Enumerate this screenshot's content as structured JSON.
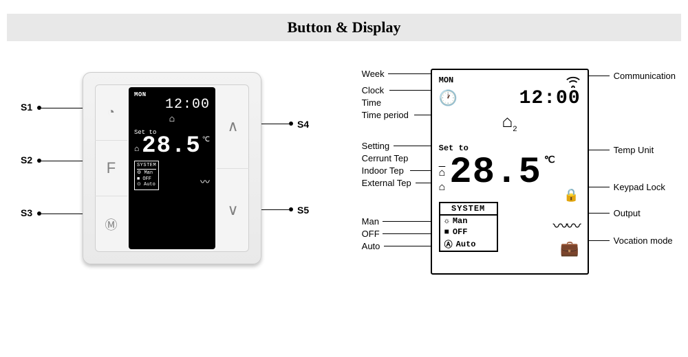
{
  "title": "Button & Display",
  "device": {
    "buttons": {
      "S1": {
        "label": "S1",
        "icon": "clock-icon",
        "glyph": "◔"
      },
      "S2": {
        "label": "S2",
        "icon": "f-button",
        "glyph": "F"
      },
      "S3": {
        "label": "S3",
        "icon": "mode-icon",
        "glyph": "Ⓜ"
      },
      "S4": {
        "label": "S4",
        "icon": "up-icon",
        "glyph": "∧"
      },
      "S5": {
        "label": "S5",
        "icon": "down-icon",
        "glyph": "∨"
      }
    },
    "lcd": {
      "week": "MON",
      "time": "12:00",
      "period_glyph": "⌂",
      "set_to": "Set to",
      "indoor_glyph": "⌂",
      "temp": "28.5",
      "unit": "℃",
      "system": {
        "header": "SYSTEM",
        "man": "⚙ Man",
        "off": "■ OFF",
        "auto": "⊙ Auto"
      },
      "heat_glyph": "〰"
    }
  },
  "legend": {
    "lcd": {
      "week": "MON",
      "clock_glyph": "🕐",
      "time": "12:00",
      "period_glyph": "⌂",
      "period_sub": "2",
      "set_to": "Set to",
      "indoor_glyph": "⌂",
      "external_glyph": "⌂",
      "temp": "28.5",
      "unit": "℃",
      "lock_glyph": "🔒",
      "system": {
        "header": "SYSTEM",
        "man_glyph": "☼",
        "man": "Man",
        "off_glyph": "■",
        "off": "OFF",
        "auto_glyph": "Ⓐ",
        "auto": "Auto"
      },
      "heat_glyph": "〰〰",
      "case_glyph": "💼"
    },
    "labels": {
      "week": "Week",
      "clock": "Clock",
      "time": "Time",
      "time_period": "Time period",
      "setting": "Setting",
      "current_tep": "Cerrunt Tep",
      "indoor_tep": "Indoor Tep",
      "external_tep": "External Tep",
      "man": "Man",
      "off": "OFF",
      "auto": "Auto",
      "communication": "Communication",
      "temp_unit": "Temp Unit",
      "keypad_lock": "Keypad Lock",
      "output": "Output",
      "vocation_mode": "Vocation mode"
    }
  }
}
